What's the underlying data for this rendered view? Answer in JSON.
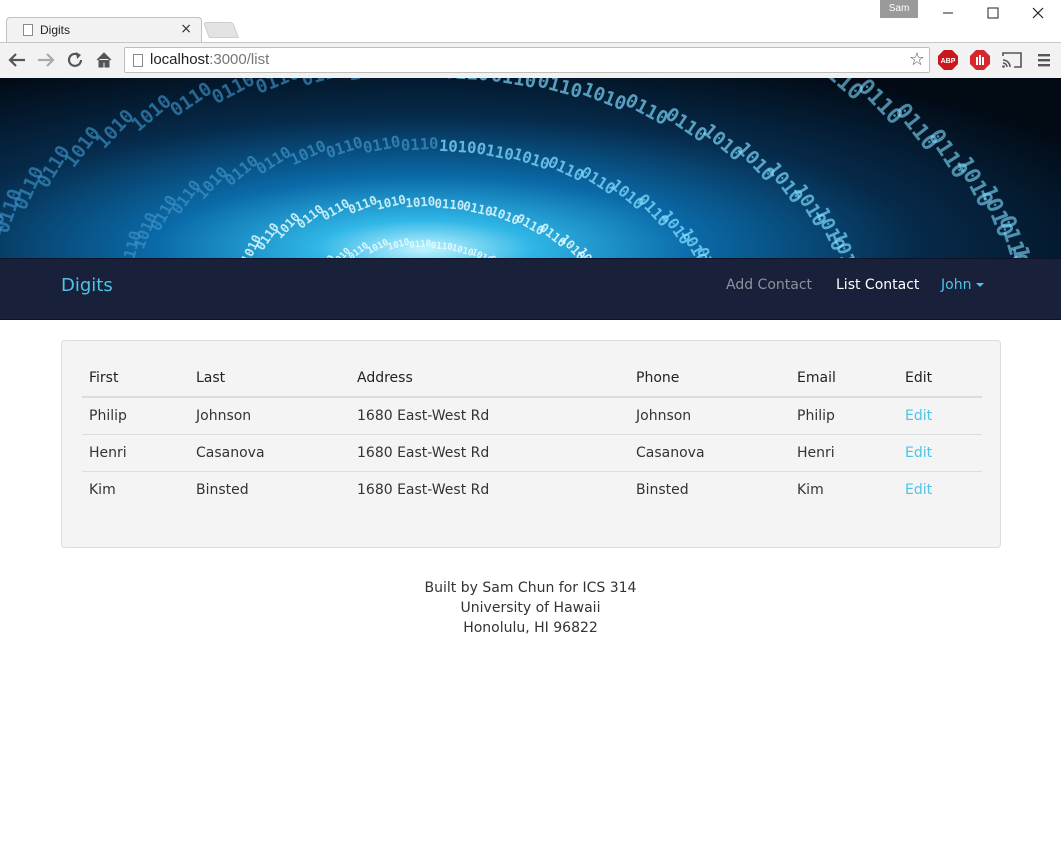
{
  "browser": {
    "tab_title": "Digits",
    "tab_close": "×",
    "profile_name": "Sam",
    "url_host": "localhost",
    "url_rest": ":3000/list",
    "star": "☆"
  },
  "navbar": {
    "brand": "Digits",
    "add_contact": "Add Contact",
    "list_contact": "List Contact",
    "user": "John"
  },
  "contacts": {
    "headers": [
      "First",
      "Last",
      "Address",
      "Phone",
      "Email",
      "Edit"
    ],
    "rows": [
      {
        "first": "Philip",
        "last": "Johnson",
        "address": "1680 East-West Rd",
        "phone": "Johnson",
        "email": "Philip",
        "edit": "Edit"
      },
      {
        "first": "Henri",
        "last": "Casanova",
        "address": "1680 East-West Rd",
        "phone": "Casanova",
        "email": "Henri",
        "edit": "Edit"
      },
      {
        "first": "Kim",
        "last": "Binsted",
        "address": "1680 East-West Rd",
        "phone": "Binsted",
        "email": "Kim",
        "edit": "Edit"
      }
    ]
  },
  "footer": {
    "line1": "Built by Sam Chun for ICS 314",
    "line2": "University of Hawaii",
    "line3": "Honolulu, HI 96822"
  },
  "colors": {
    "accent": "#4ec3e8",
    "navbar_bg": "#18203a",
    "panel_bg": "#f4f4f4"
  }
}
